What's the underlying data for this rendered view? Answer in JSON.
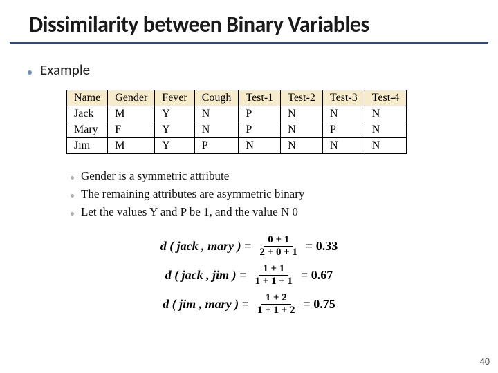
{
  "title": "Dissimilarity between Binary Variables",
  "bullet_example": "Example",
  "table": {
    "headers": [
      "Name",
      "Gender",
      "Fever",
      "Cough",
      "Test-1",
      "Test-2",
      "Test-3",
      "Test-4"
    ],
    "rows": [
      [
        "Jack",
        "M",
        "Y",
        "N",
        "P",
        "N",
        "N",
        "N"
      ],
      [
        "Mary",
        "F",
        "Y",
        "N",
        "P",
        "N",
        "P",
        "N"
      ],
      [
        "Jim",
        "M",
        "Y",
        "P",
        "N",
        "N",
        "N",
        "N"
      ]
    ]
  },
  "sub_bullets": [
    "Gender is a symmetric attribute",
    "The remaining attributes are asymmetric binary",
    "Let the values Y and P be 1, and the value N 0"
  ],
  "equations": [
    {
      "lhs": "d ( jack , mary ) =",
      "num": "0 + 1",
      "den": "2 + 0 + 1",
      "rhs": "= 0.33"
    },
    {
      "lhs": "d ( jack , jim ) =",
      "num": "1 + 1",
      "den": "1 + 1 + 1",
      "rhs": "= 0.67"
    },
    {
      "lhs": "d ( jim , mary ) =",
      "num": "1 + 2",
      "den": "1 + 1 + 2",
      "rhs": "= 0.75"
    }
  ],
  "page_number": "40"
}
